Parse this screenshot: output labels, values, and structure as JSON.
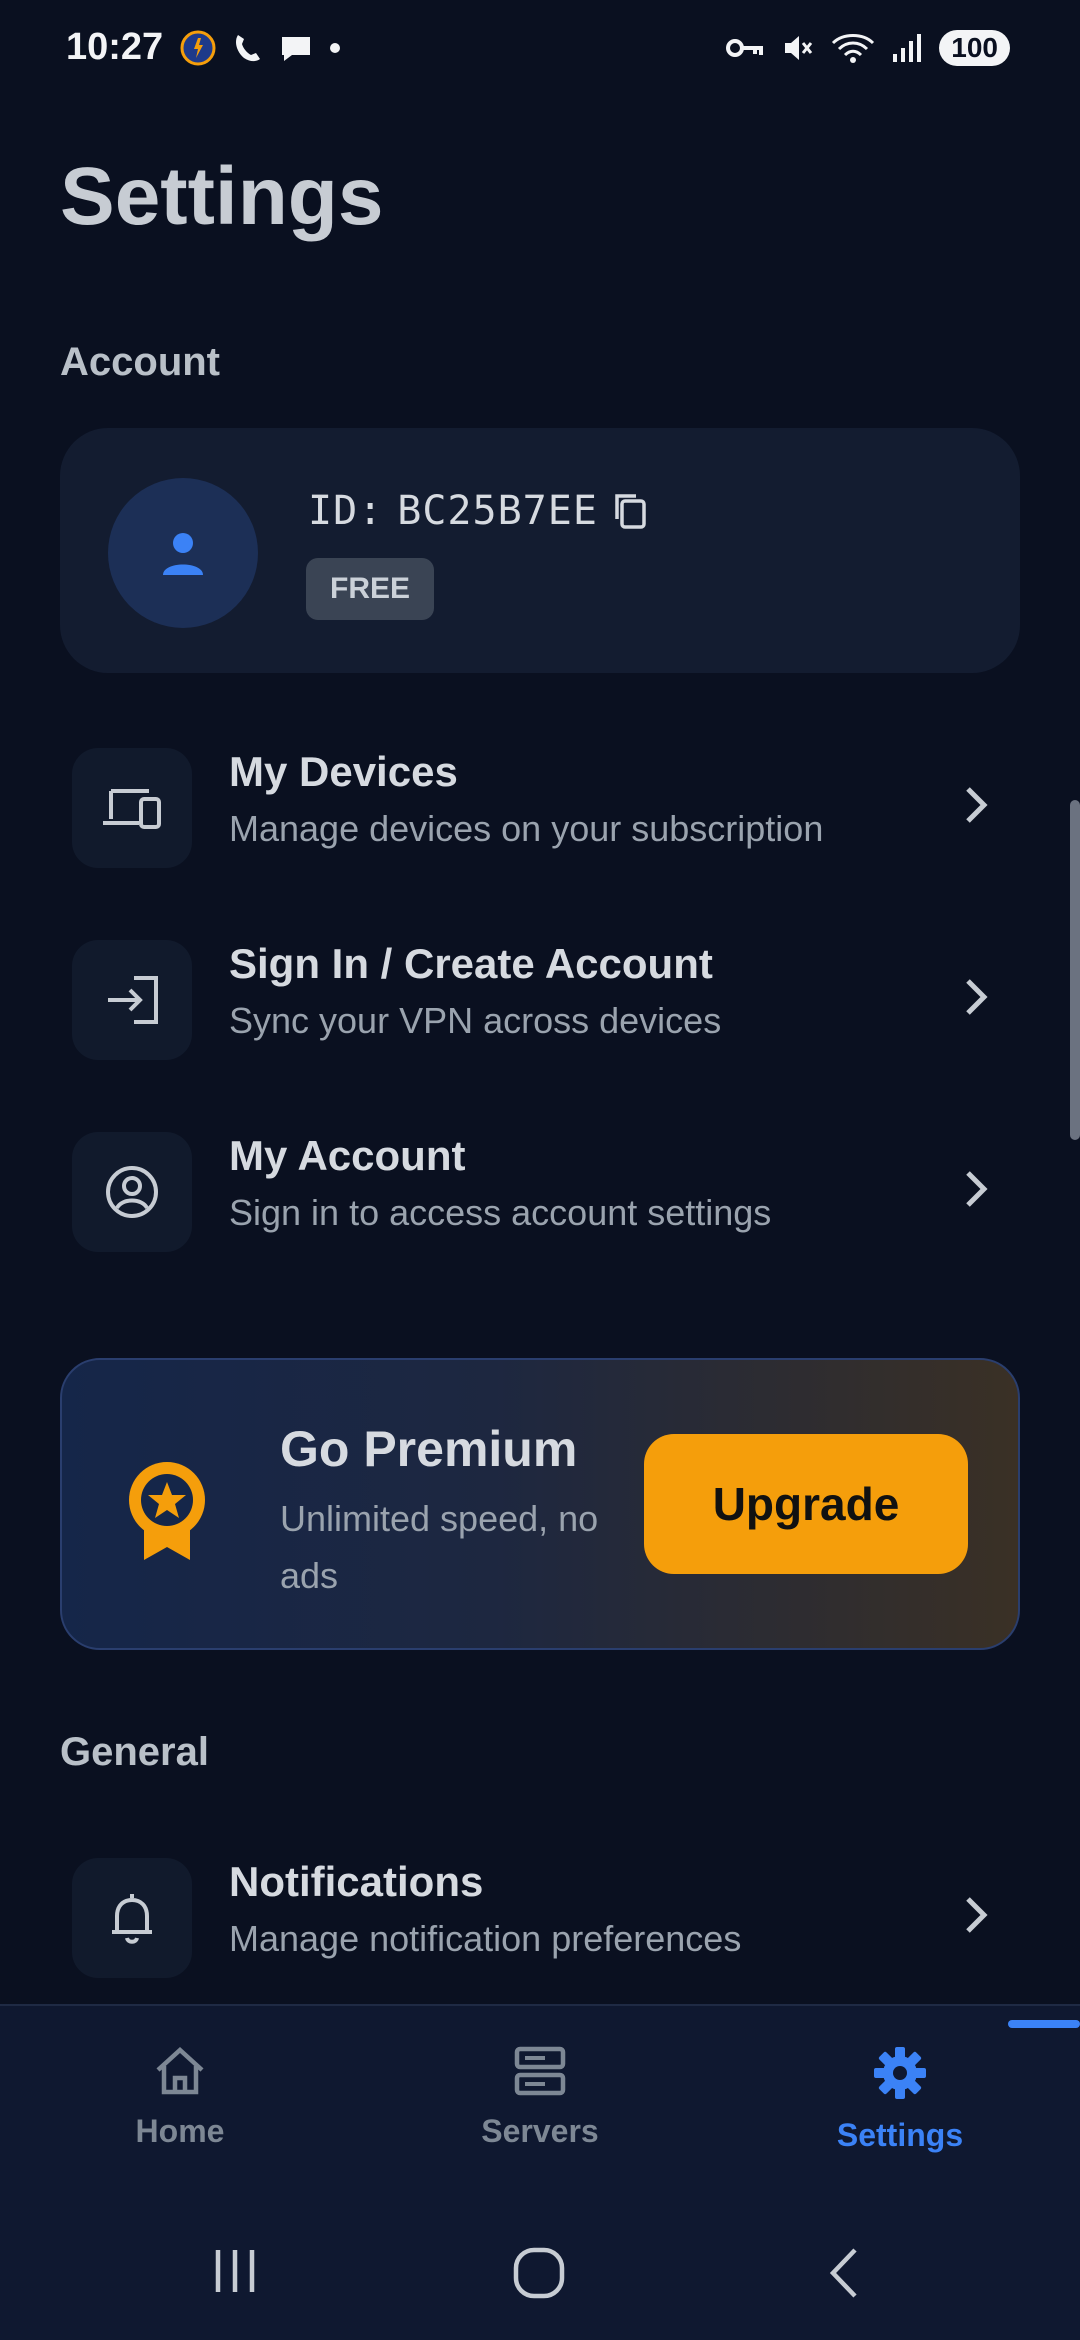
{
  "status_bar": {
    "time": "10:27",
    "battery": "100"
  },
  "page": {
    "title": "Settings"
  },
  "account_section": {
    "label": "Account",
    "id_label": "ID:",
    "id_value": "BC25B7EE",
    "plan_badge": "FREE"
  },
  "menu_items": [
    {
      "title": "My Devices",
      "subtitle": "Manage devices on your subscription",
      "icon": "devices-icon"
    },
    {
      "title": "Sign In / Create Account",
      "subtitle": "Sync your VPN across devices",
      "icon": "login-icon"
    },
    {
      "title": "My Account",
      "subtitle": "Sign in to access account settings",
      "icon": "account-circle-icon"
    }
  ],
  "premium": {
    "title": "Go Premium",
    "subtitle": "Unlimited speed, no ads",
    "button": "Upgrade"
  },
  "general_section": {
    "label": "General",
    "items": [
      {
        "title": "Notifications",
        "subtitle": "Manage notification preferences",
        "icon": "bell-icon"
      }
    ]
  },
  "bottom_nav": {
    "items": [
      {
        "label": "Home",
        "icon": "home-icon",
        "active": false
      },
      {
        "label": "Servers",
        "icon": "servers-icon",
        "active": false
      },
      {
        "label": "Settings",
        "icon": "gear-icon",
        "active": true
      }
    ]
  },
  "colors": {
    "background": "#0a1020",
    "accent": "#3b82f6",
    "premium": "#f59e0b"
  }
}
